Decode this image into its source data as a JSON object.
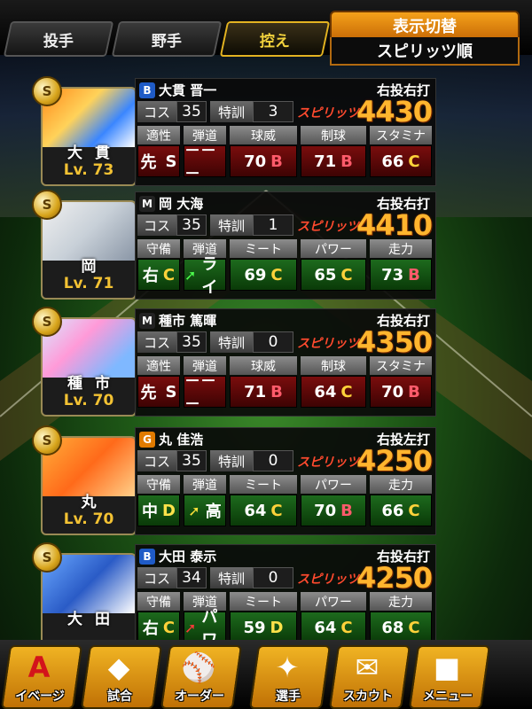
{
  "tabs": [
    {
      "label": "投手",
      "active": false
    },
    {
      "label": "野手",
      "active": false
    },
    {
      "label": "控え",
      "active": true
    }
  ],
  "sort": {
    "header": "表示切替",
    "value": "スピリッツ順"
  },
  "labels": {
    "cost": "コス",
    "tokkun": "特訓",
    "spirits": "スピリッツ"
  },
  "players": [
    {
      "badge": "S",
      "team_mark": "B",
      "team_color": "#1f5bc6",
      "portrait_name": "大貫",
      "level": "Lv. 73",
      "name": "大貫 晋一",
      "hand": "右投右打",
      "cost": "35",
      "tokkun": "3",
      "spirits": "4430",
      "type": "pitcher",
      "stat_headers": [
        "適性",
        "弾道",
        "球威",
        "制球",
        "スタミナ"
      ],
      "stats": [
        {
          "value": "先",
          "grade": "S"
        },
        {
          "value": "－－－",
          "grade": ""
        },
        {
          "value": "70",
          "grade": "B"
        },
        {
          "value": "71",
          "grade": "B"
        },
        {
          "value": "66",
          "grade": "C"
        }
      ]
    },
    {
      "badge": "S",
      "team_mark": "M",
      "team_color": "#222222",
      "portrait_name": "岡",
      "level": "Lv. 71",
      "name": "岡 大海",
      "hand": "右投右打",
      "cost": "35",
      "tokkun": "1",
      "spirits": "4410",
      "type": "batter",
      "stat_headers": [
        "守備",
        "弾道",
        "ミート",
        "パワー",
        "走力"
      ],
      "stats": [
        {
          "value": "右",
          "grade": "C"
        },
        {
          "value": "ライ",
          "grade": "",
          "arrow": "green"
        },
        {
          "value": "69",
          "grade": "C"
        },
        {
          "value": "65",
          "grade": "C"
        },
        {
          "value": "73",
          "grade": "B"
        }
      ]
    },
    {
      "badge": "S",
      "team_mark": "M",
      "team_color": "#222222",
      "portrait_name": "種市",
      "level": "Lv. 70",
      "name": "種市 篤暉",
      "hand": "右投右打",
      "cost": "35",
      "tokkun": "0",
      "spirits": "4350",
      "type": "pitcher",
      "stat_headers": [
        "適性",
        "弾道",
        "球威",
        "制球",
        "スタミナ"
      ],
      "stats": [
        {
          "value": "先",
          "grade": "S"
        },
        {
          "value": "－－－",
          "grade": ""
        },
        {
          "value": "71",
          "grade": "B"
        },
        {
          "value": "64",
          "grade": "C"
        },
        {
          "value": "70",
          "grade": "B"
        }
      ]
    },
    {
      "badge": "S",
      "team_mark": "G",
      "team_color": "#e07b00",
      "portrait_name": "丸",
      "level": "Lv. 70",
      "name": "丸 佳浩",
      "hand": "右投左打",
      "cost": "35",
      "tokkun": "0",
      "spirits": "4250",
      "type": "batter",
      "stat_headers": [
        "守備",
        "弾道",
        "ミート",
        "パワー",
        "走力"
      ],
      "stats": [
        {
          "value": "中",
          "grade": "D"
        },
        {
          "value": "高",
          "grade": "",
          "arrow": "yellow"
        },
        {
          "value": "64",
          "grade": "C"
        },
        {
          "value": "70",
          "grade": "B"
        },
        {
          "value": "66",
          "grade": "C"
        }
      ]
    },
    {
      "badge": "S",
      "team_mark": "B",
      "team_color": "#1f5bc6",
      "portrait_name": "大田",
      "level": "",
      "name": "大田 泰示",
      "hand": "右投右打",
      "cost": "34",
      "tokkun": "0",
      "spirits": "4250",
      "type": "batter",
      "stat_headers": [
        "守備",
        "弾道",
        "ミート",
        "パワー",
        "走力"
      ],
      "stats": [
        {
          "value": "右",
          "grade": "C"
        },
        {
          "value": "パワ",
          "grade": "",
          "arrow": "red"
        },
        {
          "value": "59",
          "grade": "D"
        },
        {
          "value": "64",
          "grade": "C"
        },
        {
          "value": "68",
          "grade": "C"
        }
      ]
    }
  ],
  "nav": [
    {
      "label": "イベージ",
      "icon": "A"
    },
    {
      "label": "試合",
      "icon": "◆"
    },
    {
      "label": "オーダー",
      "icon": "⚾"
    },
    {
      "label": "選手",
      "icon": "✦"
    },
    {
      "label": "スカウト",
      "icon": "✉"
    },
    {
      "label": "メニュー",
      "icon": "■"
    }
  ]
}
